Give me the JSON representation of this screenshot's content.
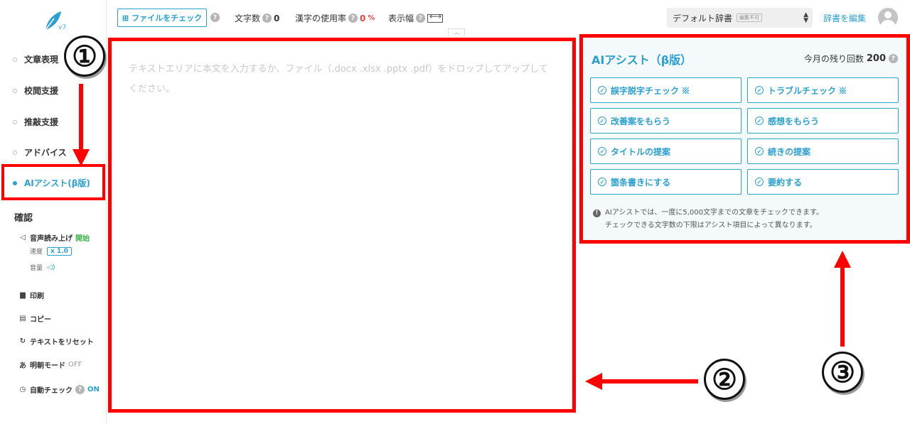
{
  "sidebar": {
    "version": "v7",
    "nav": [
      {
        "label": "文章表現"
      },
      {
        "label": "校閲支援"
      },
      {
        "label": "推敲支援"
      },
      {
        "label": "アドバイス"
      },
      {
        "label": "AIアシスト(β版)"
      }
    ],
    "confirm_title": "確認",
    "tts_label": "音声読み上げ",
    "tts_start": "開始",
    "speed_label": "速度",
    "speed_value": "x 1.0",
    "volume_label": "音量",
    "print_label": "印刷",
    "copy_label": "コピー",
    "reset_label": "テキストをリセット",
    "mincho_label": "明朝モード",
    "mincho_state": "OFF",
    "autocheck_label": "自動チェック",
    "autocheck_state": "ON"
  },
  "topbar": {
    "file_check": "ファイルをチェック",
    "char_count_label": "文字数",
    "char_count_value": "0",
    "kanji_rate_label": "漢字の使用率",
    "kanji_rate_value": "0",
    "kanji_rate_unit": "%",
    "display_width_label": "表示幅",
    "dict_value": "デフォルト辞書",
    "dict_tag": "編集不可",
    "edit_dict": "辞書を編集"
  },
  "editor": {
    "placeholder": "テキストエリアに本文を入力するか、ファイル（.docx .xlsx .pptx .pdf）をドロップしてアップしてください。"
  },
  "ai_panel": {
    "title": "AIアシスト（β版）",
    "remaining_label": "今月の残り回数",
    "remaining_value": "200",
    "buttons": [
      {
        "label": "誤字脱字チェック ※"
      },
      {
        "label": "トラブルチェック ※"
      },
      {
        "label": "改善案をもらう"
      },
      {
        "label": "感想をもらう"
      },
      {
        "label": "タイトルの提案"
      },
      {
        "label": "続きの提案"
      },
      {
        "label": "箇条書きにする"
      },
      {
        "label": "要約する"
      }
    ],
    "note_line1": "AIアシストでは、一度に5,000文字までの文章をチェックできます。",
    "note_line2": "チェックできる文字数の下限はアシスト項目によって異なります。"
  },
  "annotations": {
    "num1": "①",
    "num2": "②",
    "num3": "③"
  },
  "colors": {
    "accent": "#2a9fd0",
    "annotation_red": "#ff0000",
    "kanji_red": "#e8453c",
    "start_green": "#3bb24a"
  }
}
